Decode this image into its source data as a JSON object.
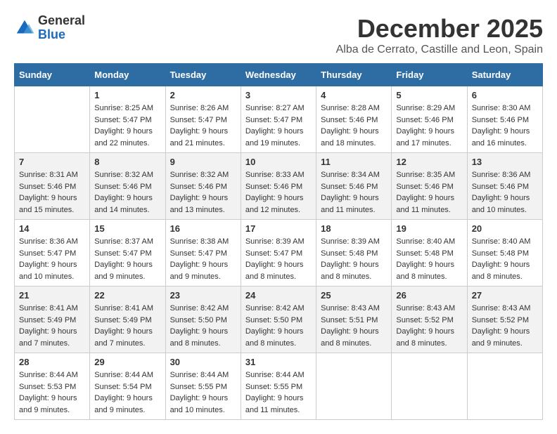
{
  "logo": {
    "general": "General",
    "blue": "Blue"
  },
  "title": {
    "month": "December 2025",
    "location": "Alba de Cerrato, Castille and Leon, Spain"
  },
  "weekdays": [
    "Sunday",
    "Monday",
    "Tuesday",
    "Wednesday",
    "Thursday",
    "Friday",
    "Saturday"
  ],
  "weeks": [
    [
      {
        "day": "",
        "sunrise": "",
        "sunset": "",
        "daylight": ""
      },
      {
        "day": "1",
        "sunrise": "Sunrise: 8:25 AM",
        "sunset": "Sunset: 5:47 PM",
        "daylight": "Daylight: 9 hours and 22 minutes."
      },
      {
        "day": "2",
        "sunrise": "Sunrise: 8:26 AM",
        "sunset": "Sunset: 5:47 PM",
        "daylight": "Daylight: 9 hours and 21 minutes."
      },
      {
        "day": "3",
        "sunrise": "Sunrise: 8:27 AM",
        "sunset": "Sunset: 5:47 PM",
        "daylight": "Daylight: 9 hours and 19 minutes."
      },
      {
        "day": "4",
        "sunrise": "Sunrise: 8:28 AM",
        "sunset": "Sunset: 5:46 PM",
        "daylight": "Daylight: 9 hours and 18 minutes."
      },
      {
        "day": "5",
        "sunrise": "Sunrise: 8:29 AM",
        "sunset": "Sunset: 5:46 PM",
        "daylight": "Daylight: 9 hours and 17 minutes."
      },
      {
        "day": "6",
        "sunrise": "Sunrise: 8:30 AM",
        "sunset": "Sunset: 5:46 PM",
        "daylight": "Daylight: 9 hours and 16 minutes."
      }
    ],
    [
      {
        "day": "7",
        "sunrise": "Sunrise: 8:31 AM",
        "sunset": "Sunset: 5:46 PM",
        "daylight": "Daylight: 9 hours and 15 minutes."
      },
      {
        "day": "8",
        "sunrise": "Sunrise: 8:32 AM",
        "sunset": "Sunset: 5:46 PM",
        "daylight": "Daylight: 9 hours and 14 minutes."
      },
      {
        "day": "9",
        "sunrise": "Sunrise: 8:32 AM",
        "sunset": "Sunset: 5:46 PM",
        "daylight": "Daylight: 9 hours and 13 minutes."
      },
      {
        "day": "10",
        "sunrise": "Sunrise: 8:33 AM",
        "sunset": "Sunset: 5:46 PM",
        "daylight": "Daylight: 9 hours and 12 minutes."
      },
      {
        "day": "11",
        "sunrise": "Sunrise: 8:34 AM",
        "sunset": "Sunset: 5:46 PM",
        "daylight": "Daylight: 9 hours and 11 minutes."
      },
      {
        "day": "12",
        "sunrise": "Sunrise: 8:35 AM",
        "sunset": "Sunset: 5:46 PM",
        "daylight": "Daylight: 9 hours and 11 minutes."
      },
      {
        "day": "13",
        "sunrise": "Sunrise: 8:36 AM",
        "sunset": "Sunset: 5:46 PM",
        "daylight": "Daylight: 9 hours and 10 minutes."
      }
    ],
    [
      {
        "day": "14",
        "sunrise": "Sunrise: 8:36 AM",
        "sunset": "Sunset: 5:47 PM",
        "daylight": "Daylight: 9 hours and 10 minutes."
      },
      {
        "day": "15",
        "sunrise": "Sunrise: 8:37 AM",
        "sunset": "Sunset: 5:47 PM",
        "daylight": "Daylight: 9 hours and 9 minutes."
      },
      {
        "day": "16",
        "sunrise": "Sunrise: 8:38 AM",
        "sunset": "Sunset: 5:47 PM",
        "daylight": "Daylight: 9 hours and 9 minutes."
      },
      {
        "day": "17",
        "sunrise": "Sunrise: 8:39 AM",
        "sunset": "Sunset: 5:47 PM",
        "daylight": "Daylight: 9 hours and 8 minutes."
      },
      {
        "day": "18",
        "sunrise": "Sunrise: 8:39 AM",
        "sunset": "Sunset: 5:48 PM",
        "daylight": "Daylight: 9 hours and 8 minutes."
      },
      {
        "day": "19",
        "sunrise": "Sunrise: 8:40 AM",
        "sunset": "Sunset: 5:48 PM",
        "daylight": "Daylight: 9 hours and 8 minutes."
      },
      {
        "day": "20",
        "sunrise": "Sunrise: 8:40 AM",
        "sunset": "Sunset: 5:48 PM",
        "daylight": "Daylight: 9 hours and 8 minutes."
      }
    ],
    [
      {
        "day": "21",
        "sunrise": "Sunrise: 8:41 AM",
        "sunset": "Sunset: 5:49 PM",
        "daylight": "Daylight: 9 hours and 7 minutes."
      },
      {
        "day": "22",
        "sunrise": "Sunrise: 8:41 AM",
        "sunset": "Sunset: 5:49 PM",
        "daylight": "Daylight: 9 hours and 7 minutes."
      },
      {
        "day": "23",
        "sunrise": "Sunrise: 8:42 AM",
        "sunset": "Sunset: 5:50 PM",
        "daylight": "Daylight: 9 hours and 8 minutes."
      },
      {
        "day": "24",
        "sunrise": "Sunrise: 8:42 AM",
        "sunset": "Sunset: 5:50 PM",
        "daylight": "Daylight: 9 hours and 8 minutes."
      },
      {
        "day": "25",
        "sunrise": "Sunrise: 8:43 AM",
        "sunset": "Sunset: 5:51 PM",
        "daylight": "Daylight: 9 hours and 8 minutes."
      },
      {
        "day": "26",
        "sunrise": "Sunrise: 8:43 AM",
        "sunset": "Sunset: 5:52 PM",
        "daylight": "Daylight: 9 hours and 8 minutes."
      },
      {
        "day": "27",
        "sunrise": "Sunrise: 8:43 AM",
        "sunset": "Sunset: 5:52 PM",
        "daylight": "Daylight: 9 hours and 9 minutes."
      }
    ],
    [
      {
        "day": "28",
        "sunrise": "Sunrise: 8:44 AM",
        "sunset": "Sunset: 5:53 PM",
        "daylight": "Daylight: 9 hours and 9 minutes."
      },
      {
        "day": "29",
        "sunrise": "Sunrise: 8:44 AM",
        "sunset": "Sunset: 5:54 PM",
        "daylight": "Daylight: 9 hours and 9 minutes."
      },
      {
        "day": "30",
        "sunrise": "Sunrise: 8:44 AM",
        "sunset": "Sunset: 5:55 PM",
        "daylight": "Daylight: 9 hours and 10 minutes."
      },
      {
        "day": "31",
        "sunrise": "Sunrise: 8:44 AM",
        "sunset": "Sunset: 5:55 PM",
        "daylight": "Daylight: 9 hours and 11 minutes."
      },
      {
        "day": "",
        "sunrise": "",
        "sunset": "",
        "daylight": ""
      },
      {
        "day": "",
        "sunrise": "",
        "sunset": "",
        "daylight": ""
      },
      {
        "day": "",
        "sunrise": "",
        "sunset": "",
        "daylight": ""
      }
    ]
  ]
}
